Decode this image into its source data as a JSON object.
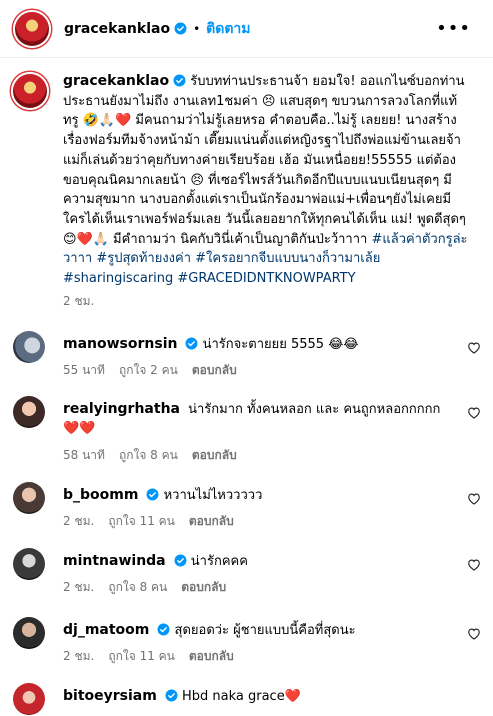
{
  "header": {
    "username": "gracekanklao",
    "separator": "•",
    "follow_label": "ติดตาม",
    "more_label": "•••"
  },
  "caption": {
    "username": "gracekanklao",
    "text": "รับบทท่านประธานจ้า ยอมใจ! ออแกไนซ์บอกท่านประธานยังมาไม่ถึง งานเลท1ชมค่า 😣 แสบสุดๆ ขบวนการลวงโลกที่แท้ทรู 🤣🙏🏻❤️ มีคนถามว่าไม่รู้เลยหรอ คำตอบคือ..ไม่รู้ เลยยย! นางสร้างเรื่องฟอร์มทีมจ้างหน้าม้า เตี๊ยมแน่นตั้งแต่หญิงรฐาไปถึงพ่อแม่ข้านเลยจ้า แม่ก็เล่นด้วยว่าคุยกับทางค่ายเรียบร้อย เฮ้อ มันเหนื่อยย!55555 แต่ต้องขอบคุณนิคมากเลยน้า 😣 ที่เซอร์ไพรส์วันเกิดอีกปีแบบแนบเนียนสุดๆ มีความสุขมาก นางบอกตั้งแต่เราเป็นนักร้องมาพ่อแม่+เพื่อนๆยังไม่เคยมีใครได้เห็นเราเพอร์ฟอร์มเลย วันนี้เลยอยากให้ทุกคนได้เห็น แม่! พูดดีสุดๆ 😊❤️🙏🏻 มีคำถามว่า นิคกับวินี่เค้าเป็นญาติกันป่ะว้าาาา ",
    "hashtags": "#แล้วค่าตัวกรูล่ะวาาา #รูปสุดท้ายงงค่า #ใครอยากจีบแบบนางก็วามาเล้ย #sharingiscaring #GRACEDIDNTKNOWPARTY",
    "time": "2 ชม."
  },
  "comments": [
    {
      "username": "manowsornsin",
      "verified": true,
      "text": "น่ารักจะตายยย 5555 😂😂",
      "time": "55 นาที",
      "likes": "ถูกใจ 2 คน",
      "reply": "ตอบกลับ"
    },
    {
      "username": "realyingrhatha",
      "verified": false,
      "text": "น่ารักมาก ทั้งคนหลอก และ คนถูกหลอกกกกก ❤️❤️",
      "time": "58 นาที",
      "likes": "ถูกใจ 8 คน",
      "reply": "ตอบกลับ"
    },
    {
      "username": "b_boomm",
      "verified": true,
      "text": "หวานไม่ไหววววว",
      "time": "2 ชม.",
      "likes": "ถูกใจ 11 คน",
      "reply": "ตอบกลับ"
    },
    {
      "username": "mintnawinda",
      "verified": true,
      "text": "น่ารักคคค",
      "time": "2 ชม.",
      "likes": "ถูกใจ 8 คน",
      "reply": "ตอบกลับ"
    },
    {
      "username": "dj_matoom",
      "verified": true,
      "text": "สุดยอดว่ะ ผู้ชายแบบนี้คือที่สุดนะ",
      "time": "2 ชม.",
      "likes": "ถูกใจ 11 คน",
      "reply": "ตอบกลับ"
    },
    {
      "username": "bitoeyrsiam",
      "verified": true,
      "text": "Hbd naka grace❤️",
      "time": "",
      "likes": "",
      "reply": ""
    }
  ],
  "colors": {
    "verified": "#0095f6",
    "link": "#00376b",
    "muted": "#737373",
    "follow": "#0095f6"
  },
  "icons": {
    "verified": "verified-badge-icon",
    "like": "heart-outline-icon",
    "more": "more-options-icon"
  }
}
